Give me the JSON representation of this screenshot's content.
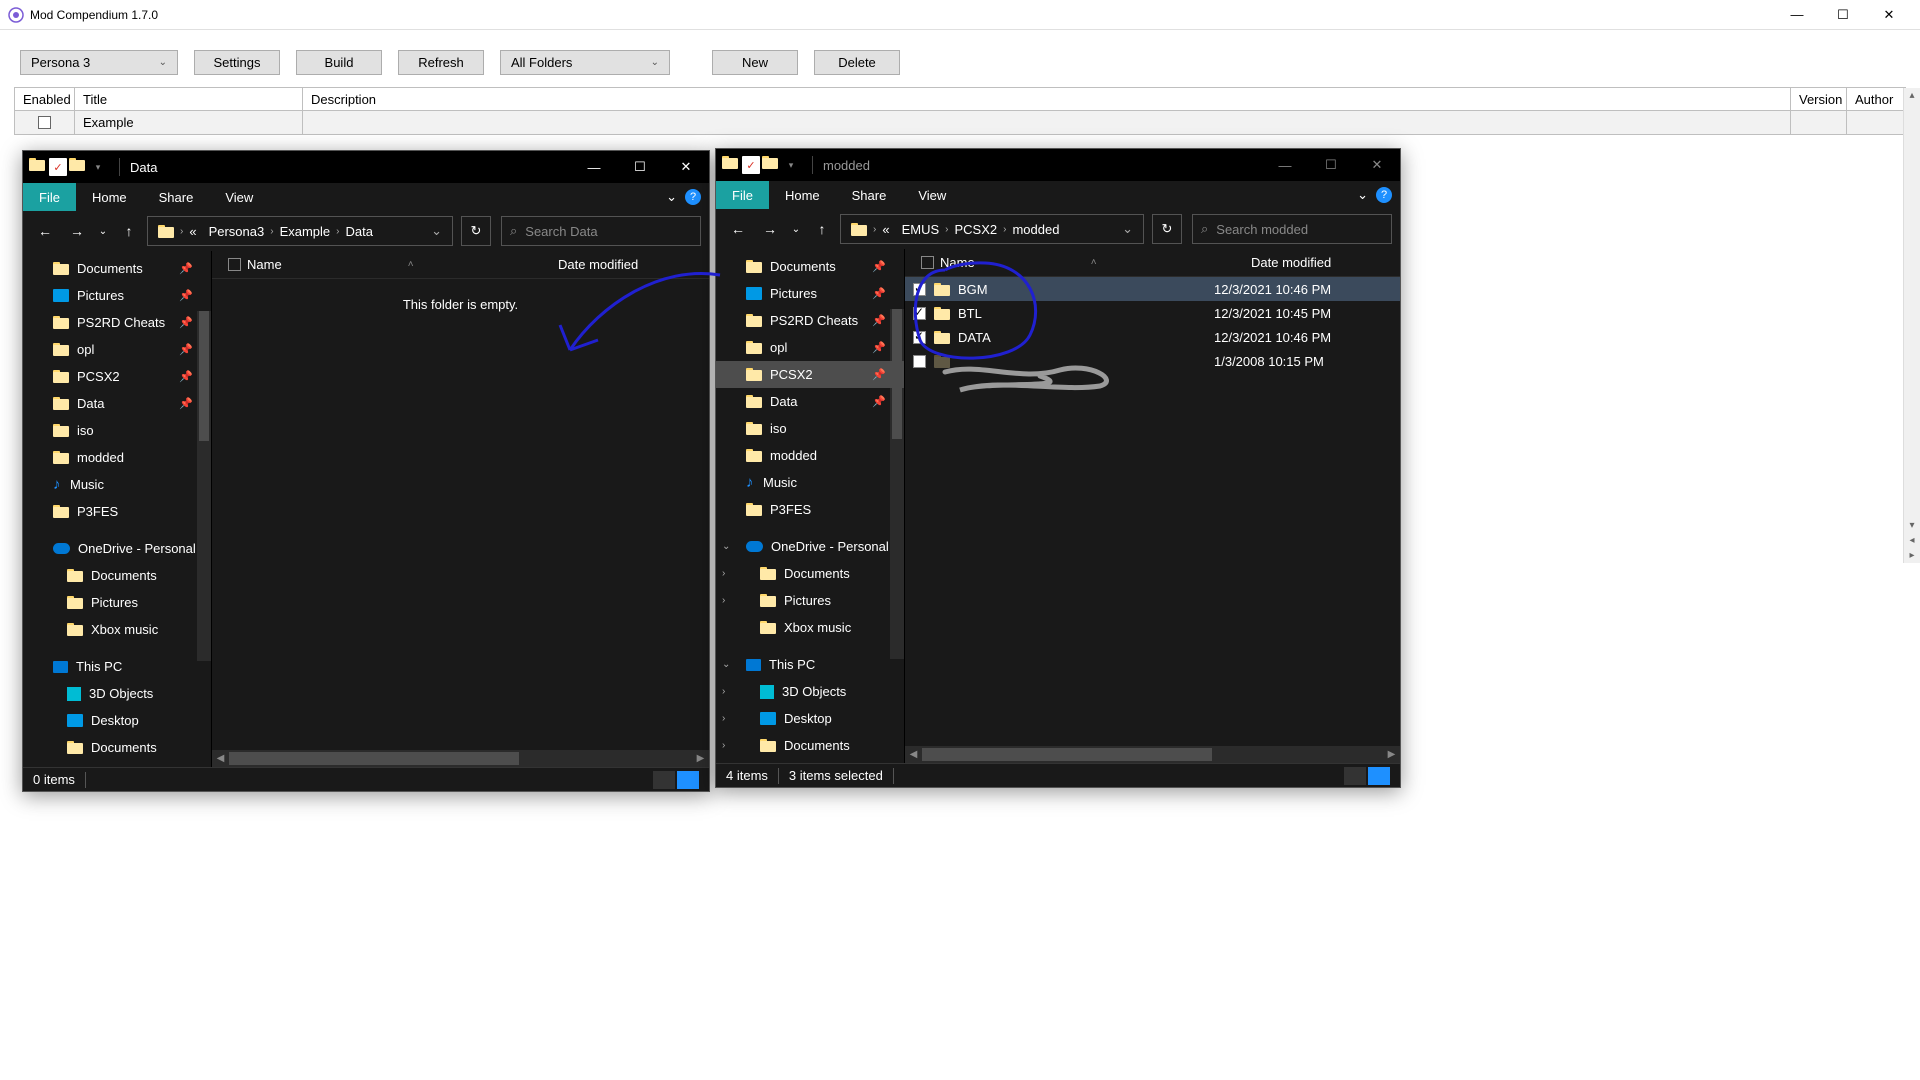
{
  "app": {
    "title": "Mod Compendium 1.7.0",
    "sys": {
      "min": "—",
      "max": "☐",
      "close": "✕"
    }
  },
  "toolbar": {
    "game_combo": "Persona 3",
    "settings": "Settings",
    "build": "Build",
    "refresh": "Refresh",
    "folders_combo": "All Folders",
    "new": "New",
    "delete": "Delete"
  },
  "grid": {
    "cols": {
      "enabled": "Enabled",
      "title": "Title",
      "desc": "Description",
      "version": "Version",
      "author": "Author"
    },
    "row": {
      "title": "Example"
    }
  },
  "explorer_left": {
    "title": "Data",
    "ribbon": {
      "file": "File",
      "home": "Home",
      "share": "Share",
      "view": "View"
    },
    "crumbs": [
      "Persona3",
      "Example",
      "Data"
    ],
    "crumb_prefix": "«",
    "search_placeholder": "Search Data",
    "cols": {
      "name": "Name",
      "date": "Date modified"
    },
    "empty": "This folder is empty.",
    "status": "0 items",
    "nav": [
      {
        "icon": "folder",
        "label": "Documents",
        "pin": true
      },
      {
        "icon": "pic",
        "label": "Pictures",
        "pin": true
      },
      {
        "icon": "folder",
        "label": "PS2RD Cheats",
        "pin": true
      },
      {
        "icon": "folder",
        "label": "opl",
        "pin": true
      },
      {
        "icon": "folder",
        "label": "PCSX2",
        "pin": true
      },
      {
        "icon": "folder",
        "label": "Data",
        "pin": true
      },
      {
        "icon": "folder",
        "label": "iso"
      },
      {
        "icon": "folder",
        "label": "modded"
      },
      {
        "icon": "music",
        "label": "Music"
      },
      {
        "icon": "folder",
        "label": "P3FES"
      },
      {
        "gap": true
      },
      {
        "icon": "cloud",
        "label": "OneDrive - Personal"
      },
      {
        "icon": "folder",
        "label": "Documents",
        "l2": true
      },
      {
        "icon": "folder",
        "label": "Pictures",
        "l2": true
      },
      {
        "icon": "folder",
        "label": "Xbox music",
        "l2": true
      },
      {
        "gap": true
      },
      {
        "icon": "pc",
        "label": "This PC"
      },
      {
        "icon": "obj",
        "label": "3D Objects",
        "l2": true
      },
      {
        "icon": "pic",
        "label": "Desktop",
        "l2": true
      },
      {
        "icon": "folder",
        "label": "Documents",
        "l2": true
      }
    ]
  },
  "explorer_right": {
    "title": "modded",
    "ribbon": {
      "file": "File",
      "home": "Home",
      "share": "Share",
      "view": "View"
    },
    "crumbs": [
      "EMUS",
      "PCSX2",
      "modded"
    ],
    "crumb_prefix": "«",
    "search_placeholder": "Search modded",
    "cols": {
      "name": "Name",
      "date": "Date modified"
    },
    "files": [
      {
        "name": "BGM",
        "date": "12/3/2021 10:46 PM",
        "checked": true,
        "sel": true
      },
      {
        "name": "BTL",
        "date": "12/3/2021 10:45 PM",
        "checked": true
      },
      {
        "name": "DATA",
        "date": "12/3/2021 10:46 PM",
        "checked": true
      },
      {
        "name": "",
        "date": "1/3/2008 10:15 PM",
        "checked": false,
        "scribbled": true
      }
    ],
    "status_items": "4 items",
    "status_sel": "3 items selected",
    "nav": [
      {
        "icon": "folder",
        "label": "Documents",
        "pin": true
      },
      {
        "icon": "pic",
        "label": "Pictures",
        "pin": true
      },
      {
        "icon": "folder",
        "label": "PS2RD Cheats",
        "pin": true
      },
      {
        "icon": "folder",
        "label": "opl",
        "pin": true
      },
      {
        "icon": "folder",
        "label": "PCSX2",
        "pin": true,
        "sel": true
      },
      {
        "icon": "folder",
        "label": "Data",
        "pin": true
      },
      {
        "icon": "folder",
        "label": "iso"
      },
      {
        "icon": "folder",
        "label": "modded"
      },
      {
        "icon": "music",
        "label": "Music"
      },
      {
        "icon": "folder",
        "label": "P3FES"
      },
      {
        "gap": true
      },
      {
        "icon": "cloud",
        "label": "OneDrive - Personal",
        "exp": "⌄"
      },
      {
        "icon": "folder",
        "label": "Documents",
        "l2": true,
        "exp": "›"
      },
      {
        "icon": "folder",
        "label": "Pictures",
        "l2": true,
        "exp": "›"
      },
      {
        "icon": "folder",
        "label": "Xbox music",
        "l2": true
      },
      {
        "gap": true
      },
      {
        "icon": "pc",
        "label": "This PC",
        "exp": "⌄"
      },
      {
        "icon": "obj",
        "label": "3D Objects",
        "l2": true,
        "exp": "›"
      },
      {
        "icon": "pic",
        "label": "Desktop",
        "l2": true,
        "exp": "›"
      },
      {
        "icon": "folder",
        "label": "Documents",
        "l2": true,
        "exp": "›"
      }
    ]
  }
}
